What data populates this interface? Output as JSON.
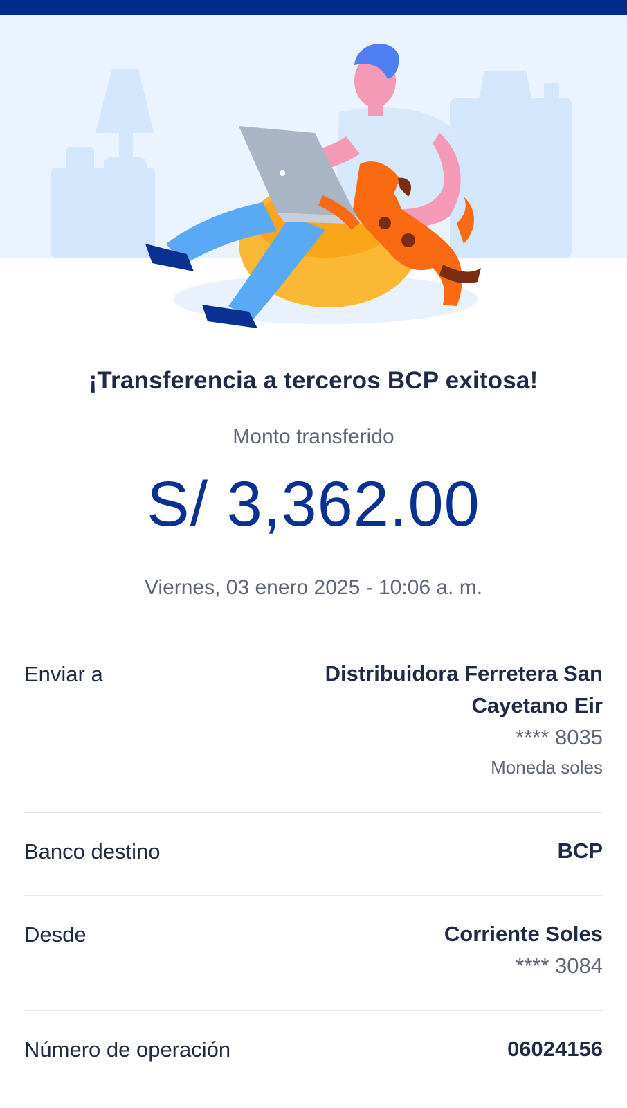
{
  "header": {
    "color": "#002a8d"
  },
  "result": {
    "title": "¡Transferencia a terceros BCP exitosa!",
    "subtitle": "Monto transferido",
    "amount": "S/ 3,362.00",
    "datetime": "Viernes, 03 enero 2025 - 10:06 a. m."
  },
  "details": {
    "send_to": {
      "label": "Enviar a",
      "name_line1": "Distribuidora Ferretera San",
      "name_line2": "Cayetano Eir",
      "account": "**** 8035",
      "currency": "Moneda soles"
    },
    "bank": {
      "label": "Banco destino",
      "value": "BCP"
    },
    "from": {
      "label": "Desde",
      "account_type": "Corriente Soles",
      "account": "**** 3084"
    },
    "operation": {
      "label": "Número de operación",
      "value": "06024156"
    }
  },
  "colors": {
    "accent": "#0a3092",
    "text": "#1f2a44",
    "muted": "#5e6574",
    "divider": "#e5e7eb"
  },
  "illustration": {
    "icon": "person-with-laptop-and-dog-illustration"
  }
}
